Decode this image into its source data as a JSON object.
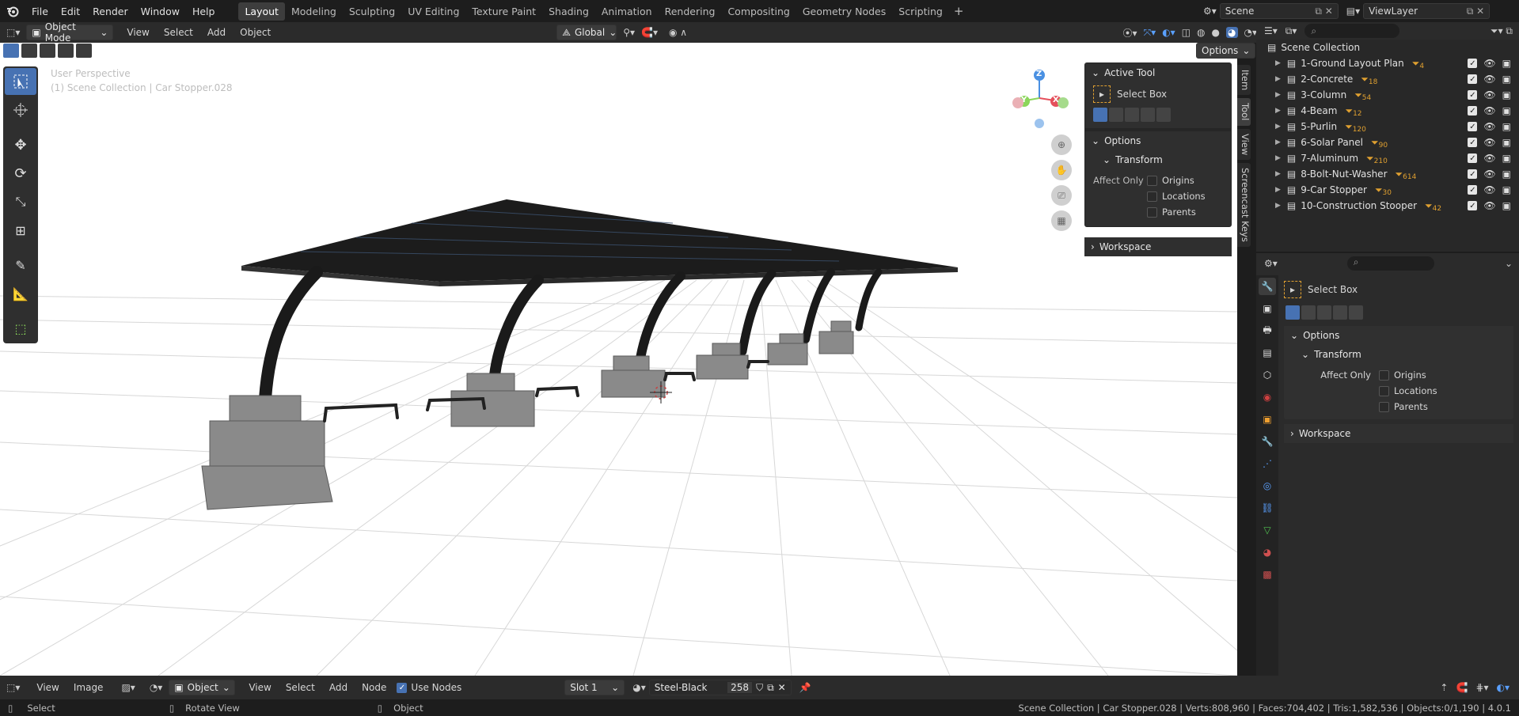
{
  "topbar": {
    "menu": [
      "File",
      "Edit",
      "Render",
      "Window",
      "Help"
    ],
    "workspaces": [
      "Layout",
      "Modeling",
      "Sculpting",
      "UV Editing",
      "Texture Paint",
      "Shading",
      "Animation",
      "Rendering",
      "Compositing",
      "Geometry Nodes",
      "Scripting"
    ],
    "active_workspace": "Layout",
    "scene_name": "Scene",
    "view_layer": "ViewLayer"
  },
  "viewport_header": {
    "mode": "Object Mode",
    "menus": [
      "View",
      "Select",
      "Add",
      "Object"
    ],
    "transform_orientation": "Global",
    "options_label": "Options"
  },
  "viewport": {
    "perspective_label": "User Perspective",
    "context_label": "(1) Scene Collection | Car Stopper.028",
    "gizmo": {
      "z": "Z",
      "y": "Y",
      "x": "X"
    }
  },
  "npanel": {
    "active_tool_title": "Active Tool",
    "tool_name": "Select Box",
    "options_title": "Options",
    "transform_title": "Transform",
    "affect_only_label": "Affect Only",
    "affect_items": [
      "Origins",
      "Locations",
      "Parents"
    ],
    "workspace_title": "Workspace",
    "tabs": [
      "Item",
      "Tool",
      "View",
      "Screencast Keys"
    ],
    "active_tab": "Tool"
  },
  "outliner": {
    "root": "Scene Collection",
    "collections": [
      {
        "name": "1-Ground Layout Plan",
        "count": "4"
      },
      {
        "name": "2-Concrete",
        "count": "18"
      },
      {
        "name": "3-Column",
        "count": "54"
      },
      {
        "name": "4-Beam",
        "count": "12"
      },
      {
        "name": "5-Purlin",
        "count": "120"
      },
      {
        "name": "6-Solar Panel",
        "count": "90"
      },
      {
        "name": "7-Aluminum",
        "count": "210"
      },
      {
        "name": "8-Bolt-Nut-Washer",
        "count": "614"
      },
      {
        "name": "9-Car Stopper",
        "count": "30"
      },
      {
        "name": "10-Construction Stooper",
        "count": "42"
      }
    ]
  },
  "properties": {
    "tool_name": "Select Box",
    "options_title": "Options",
    "transform_title": "Transform",
    "affect_only_label": "Affect Only",
    "affect_items": [
      "Origins",
      "Locations",
      "Parents"
    ],
    "workspace_title": "Workspace"
  },
  "bottom_header": {
    "menus_left": [
      "View",
      "Image"
    ],
    "object_type": "Object",
    "menus_mid": [
      "View",
      "Select",
      "Add",
      "Node"
    ],
    "use_nodes_label": "Use Nodes",
    "slot": "Slot 1",
    "material": "Steel-Black",
    "user_count": "258"
  },
  "status": {
    "select": "Select",
    "rotate": "Rotate View",
    "object": "Object",
    "stats": "Scene Collection | Car Stopper.028 | Verts:808,960 | Faces:704,402 | Tris:1,582,536 | Objects:0/1,190 | 4.0.1"
  },
  "colors": {
    "accent": "#4772b3",
    "bg_dark": "#1d1d1d",
    "panel": "#2b2b2b",
    "viewport_bg": "#ffffff",
    "axis_x": "#e5505c",
    "axis_y": "#8bd65a",
    "axis_z": "#4a90e2"
  }
}
